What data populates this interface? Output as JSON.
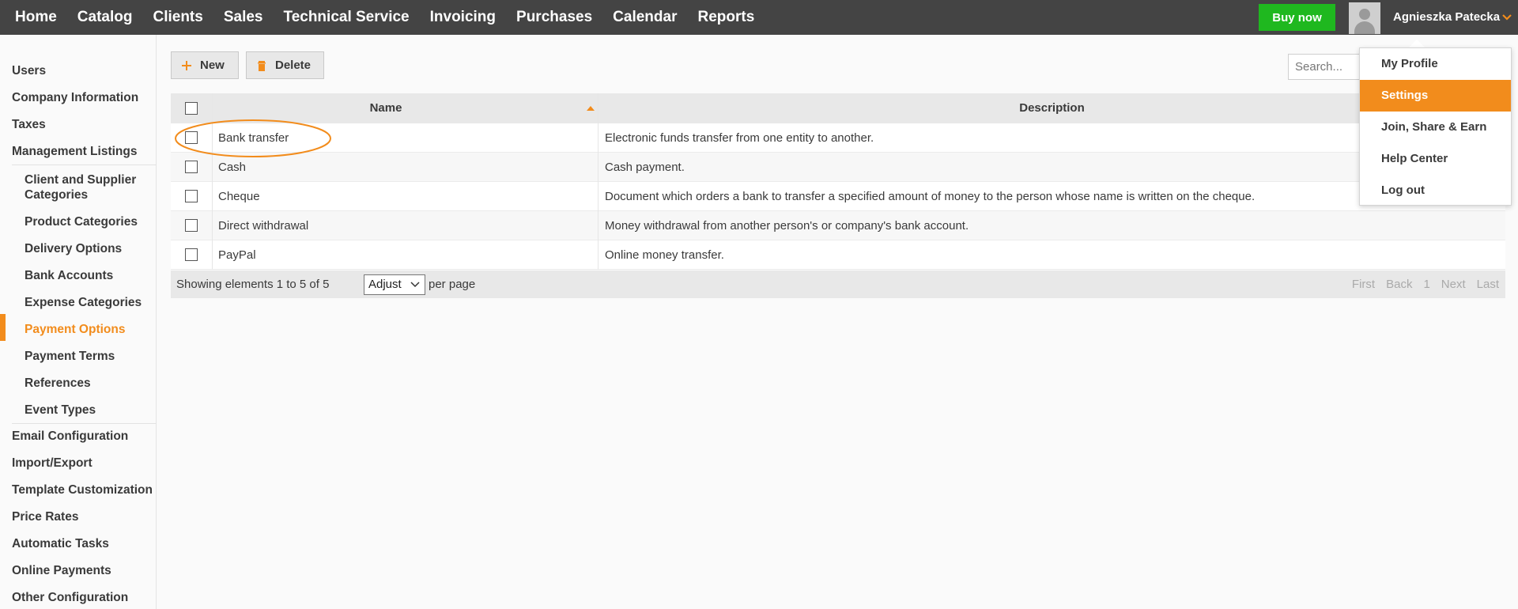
{
  "topnav": {
    "items": [
      "Home",
      "Catalog",
      "Clients",
      "Sales",
      "Technical Service",
      "Invoicing",
      "Purchases",
      "Calendar",
      "Reports"
    ],
    "buy_now": "Buy now",
    "user_name": "Agnieszka Patecka"
  },
  "sidebar": {
    "top_items": [
      "Users",
      "Company Information",
      "Taxes",
      "Management Listings"
    ],
    "sub_items": [
      "Client and Supplier Categories",
      "Product Categories",
      "Delivery Options",
      "Bank Accounts",
      "Expense Categories",
      "Payment Options",
      "Payment Terms",
      "References",
      "Event Types"
    ],
    "bottom_items": [
      "Email Configuration",
      "Import/Export",
      "Template Customization",
      "Price Rates",
      "Automatic Tasks",
      "Online Payments",
      "Other Configuration"
    ],
    "active_item": "Payment Options"
  },
  "toolbar": {
    "new_label": "New",
    "delete_label": "Delete",
    "search_placeholder": "Search..."
  },
  "table": {
    "columns": [
      "Name",
      "Description"
    ],
    "sort_column": "Name",
    "rows": [
      {
        "name": "Bank transfer",
        "description": "Electronic funds transfer from one entity to another."
      },
      {
        "name": "Cash",
        "description": "Cash payment."
      },
      {
        "name": "Cheque",
        "description": "Document which orders a bank to transfer a specified amount of money to the person whose name is written on the cheque."
      },
      {
        "name": "Direct withdrawal",
        "description": "Money withdrawal from another person's or company's bank account."
      },
      {
        "name": "PayPal",
        "description": "Online money transfer."
      }
    ],
    "footer": {
      "showing": "Showing elements 1 to 5 of 5",
      "per_page_value": "Adjust",
      "per_page_label": "per page",
      "pager": [
        "First",
        "Back",
        "1",
        "Next",
        "Last"
      ]
    }
  },
  "user_menu": {
    "items": [
      "My Profile",
      "Settings",
      "Join, Share & Earn",
      "Help Center",
      "Log out"
    ],
    "active_item": "Settings"
  },
  "colors": {
    "topbar": "#444444",
    "accent": "#f28c1c",
    "buy_button": "#1fb81f"
  }
}
